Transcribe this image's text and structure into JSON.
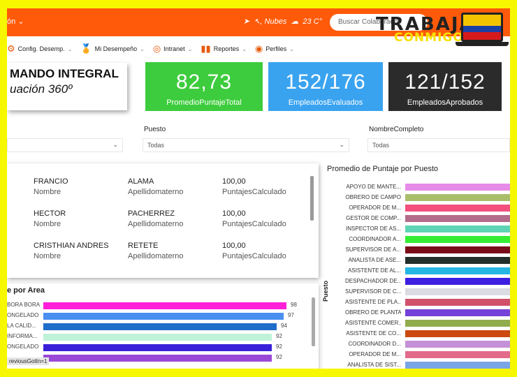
{
  "topbar": {
    "app": "ón",
    "weather": "↖, Nubes",
    "temp": "23 C°",
    "search_placeholder": "Buscar Colaborador"
  },
  "logo": {
    "line1": "TRABAJA",
    "line2": "CONMIGO"
  },
  "nav": [
    {
      "label": "Config. Desemp.",
      "icon": "settings-icon"
    },
    {
      "label": "Mi Desempeño",
      "icon": "medal-icon"
    },
    {
      "label": "Intranet",
      "icon": "globe-icon"
    },
    {
      "label": "Reportes",
      "icon": "bar-chart-icon"
    },
    {
      "label": "Perfiles",
      "icon": "profile-icon"
    }
  ],
  "title_card": {
    "title": "MANDO INTEGRAL",
    "subtitle": "uación 360º"
  },
  "kpis": [
    {
      "value": "82,73",
      "label": "PromedioPuntajeTotal",
      "color": "#3dcc3d"
    },
    {
      "value": "152/176",
      "label": "EmpleadosEvaluados",
      "color": "#3aa3f0"
    },
    {
      "value": "121/152",
      "label": "EmpleadosAprobados",
      "color": "#2b2b2b"
    }
  ],
  "filters": [
    {
      "label": "",
      "value": ""
    },
    {
      "label": "Puesto",
      "value": "Todas"
    },
    {
      "label": "NombreCompleto",
      "value": "Todas"
    }
  ],
  "people": [
    {
      "nombre": "FRANCIO",
      "apellido": "ALAMA",
      "puntaje": "100,00"
    },
    {
      "nombre": "HECTOR",
      "apellido": "PACHERREZ",
      "puntaje": "100,00"
    },
    {
      "nombre": "CRISTHIAN ANDRES",
      "apellido": "RETETE",
      "puntaje": "100,00"
    }
  ],
  "people_labels": {
    "nombre": "Nombre",
    "apellido": "Apellidomaterno",
    "puntaje": "PuntajesCalculado"
  },
  "area_chart": {
    "title": "e por Area",
    "rows": [
      {
        "label": "BORA BORA",
        "value": 98,
        "color": "#ff1fd9"
      },
      {
        "label": "ONGELADO",
        "value": 97,
        "color": "#4a8ff0"
      },
      {
        "label": "LA CALID...",
        "value": 94,
        "color": "#1f6ec9"
      },
      {
        "label": "INFORMA...",
        "value": 92,
        "color": "#bff2d9"
      },
      {
        "label": "ONGELADO",
        "value": 92,
        "color": "#3a1fd9"
      },
      {
        "label": "",
        "value": 92,
        "color": "#9a49d6"
      }
    ],
    "tooltip": "reviousGotIn=1"
  },
  "chart_data": {
    "type": "bar",
    "title": "Promedio de Puntaje por Puesto",
    "ylabel": "Puesto",
    "categories": [
      "APOYO DE MANTE...",
      "OBRERO DE CAMPO",
      "OPERADOR DE M...",
      "GESTOR DE COMP...",
      "INSPECTOR DE AS...",
      "COORDINADOR A...",
      "SUPERVISOR DE A...",
      "ANALISTA DE ASE...",
      "ASISTENTE DE AL...",
      "DESPACHADOR DE...",
      "SUPERVISOR DE C...",
      "ASISTENTE DE PLA...",
      "OBRERO DE PLANTA",
      "ASISTENTE COMER...",
      "ASISTENTE DE CO...",
      "COORDINADOR D...",
      "OPERADOR DE M...",
      "ANALISTA DE SIST..."
    ],
    "colors": [
      "#e58be8",
      "#a9be6b",
      "#f24f7e",
      "#b56b8a",
      "#5fd4b4",
      "#35ee34",
      "#7a0b19",
      "#222f2a",
      "#25b6e3",
      "#3c1fe0",
      "#dadbe3",
      "#d1506a",
      "#7442d8",
      "#90ac4d",
      "#cc4a10",
      "#c490d8",
      "#e26a8a",
      "#7aa6e6"
    ]
  }
}
